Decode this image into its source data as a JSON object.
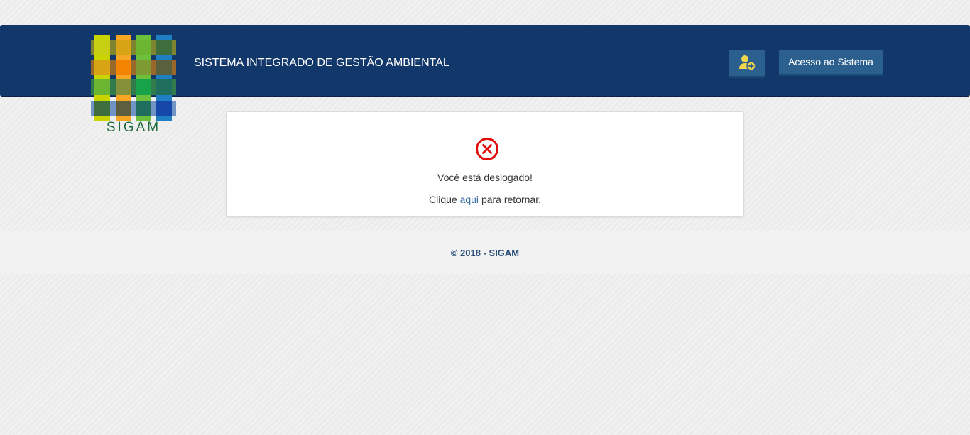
{
  "header": {
    "title": "SISTEMA INTEGRADO DE GESTÃO AMBIENTAL",
    "logo_text": "SIGAM",
    "register_icon": "user-plus-icon",
    "access_button_label": "Acesso ao Sistema"
  },
  "message": {
    "icon": "error-circle-x-icon",
    "text": "Você está deslogado!",
    "return_prefix": "Clique",
    "return_link": "aqui",
    "return_suffix": "para retornar."
  },
  "footer": {
    "text": "© 2018 - SIGAM"
  },
  "colors": {
    "header_bg": "#12376a",
    "button_bg": "#2b5f8d",
    "error_red": "#e10b0b",
    "link": "#3a6ea5",
    "footer_text": "#2b4f7a",
    "logo_text": "#1f6a3e"
  }
}
